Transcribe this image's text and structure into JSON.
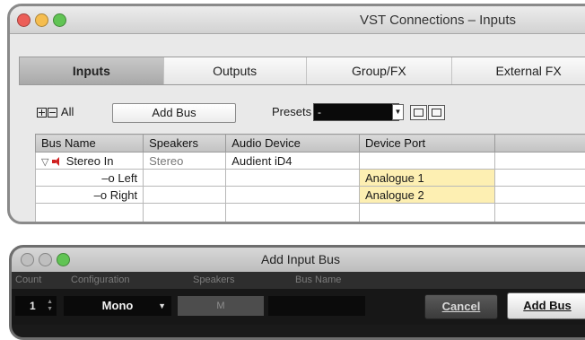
{
  "main_window": {
    "title": "VST Connections – Inputs",
    "tabs": [
      {
        "label": "Inputs",
        "active": true
      },
      {
        "label": "Outputs",
        "active": false
      },
      {
        "label": "Group/FX",
        "active": false
      },
      {
        "label": "External FX",
        "active": false
      }
    ],
    "toolbar": {
      "all_label": "All",
      "add_bus_label": "Add Bus",
      "presets_label": "Presets",
      "presets_value": "-"
    },
    "table": {
      "columns": [
        "Bus Name",
        "Speakers",
        "Audio Device",
        "Device Port",
        ""
      ],
      "rows": [
        {
          "bus_name": "Stereo In",
          "speakers": "Stereo",
          "audio_device": "Audient iD4",
          "device_port": ""
        },
        {
          "bus_name": "Left",
          "speakers": "",
          "audio_device": "",
          "device_port": "Analogue 1"
        },
        {
          "bus_name": "Right",
          "speakers": "",
          "audio_device": "",
          "device_port": "Analogue 2"
        }
      ]
    }
  },
  "dialog": {
    "title": "Add Input Bus",
    "headers": {
      "count": "Count",
      "configuration": "Configuration",
      "speakers": "Speakers",
      "bus_name": "Bus Name"
    },
    "count_value": "1",
    "configuration_value": "Mono",
    "speakers_value": "M",
    "bus_name_value": "",
    "cancel_label": "Cancel",
    "add_bus_label": "Add Bus"
  },
  "colors": {
    "device_port_highlight": "#fdefb2",
    "active_tab": "#b5b5b5",
    "dialog_background": "#1a1a1a"
  }
}
